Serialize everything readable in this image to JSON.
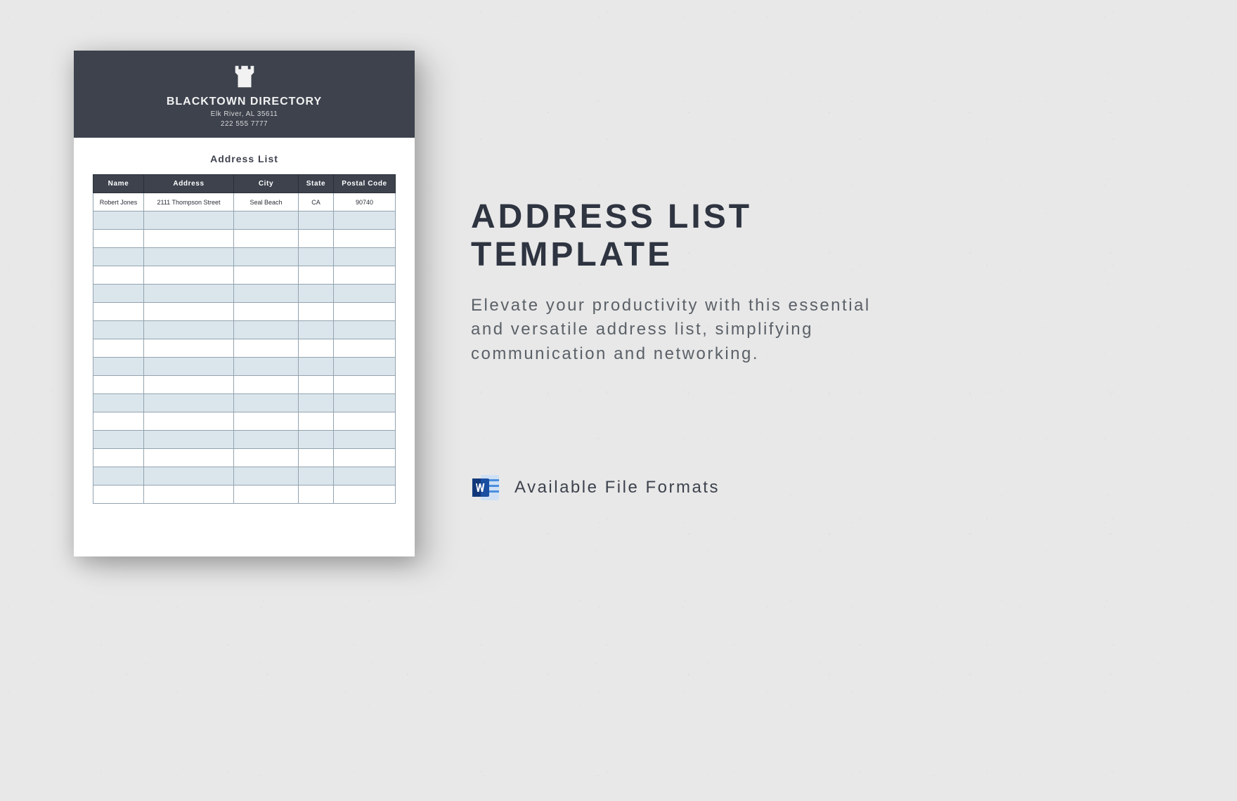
{
  "doc": {
    "brand": "BLACKTOWN DIRECTORY",
    "address_line": "Elk River, AL 35611",
    "phone_line": "222 555 7777",
    "section_title": "Address List",
    "columns": [
      "Name",
      "Address",
      "City",
      "State",
      "Postal Code"
    ],
    "rows": [
      {
        "name": "Robert Jones",
        "address": "2111 Thompson Street",
        "city": "Seal Beach",
        "state": "CA",
        "postal": "90740"
      }
    ],
    "empty_rows": 16
  },
  "promo": {
    "headline_1": "ADDRESS LIST",
    "headline_2": "TEMPLATE",
    "sub": "Elevate your productivity with this essential and versatile address list, simplifying communication and networking.",
    "formats_label": "Available File Formats"
  },
  "icons": {
    "logo": "castle-icon",
    "word": "word-icon"
  },
  "colors": {
    "header_bg": "#3d424d",
    "row_alt": "#dbe6ec"
  }
}
